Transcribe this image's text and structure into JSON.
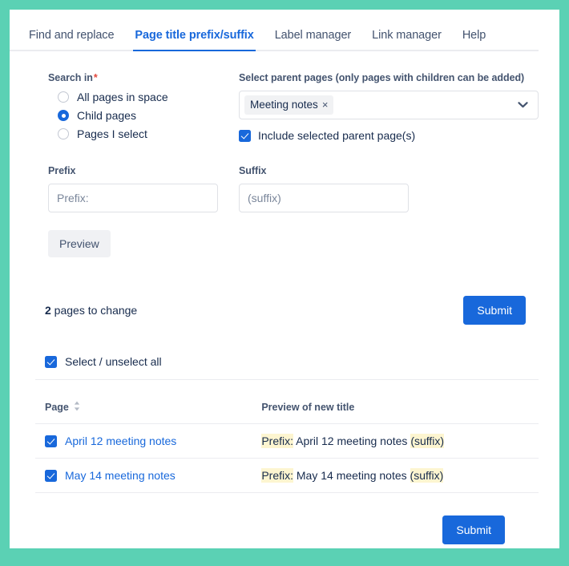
{
  "theme": {
    "accent_blue": "#1868db",
    "frame_teal": "#5bd1b4",
    "highlight_yellow": "#fdf5d0",
    "required_red": "#e2483d"
  },
  "tabs": [
    {
      "label": "Find and replace",
      "active": false
    },
    {
      "label": "Page title prefix/suffix",
      "active": true
    },
    {
      "label": "Label manager",
      "active": false
    },
    {
      "label": "Link manager",
      "active": false
    },
    {
      "label": "Help",
      "active": false
    }
  ],
  "search_in": {
    "label": "Search in",
    "required_marker": "*",
    "options": [
      {
        "label": "All pages in space",
        "selected": false
      },
      {
        "label": "Child pages",
        "selected": true
      },
      {
        "label": "Pages I select",
        "selected": false
      }
    ]
  },
  "parent_pages": {
    "label": "Select parent pages (only pages with children can be added)",
    "chips": [
      {
        "label": "Meeting notes",
        "remove_icon": "×"
      }
    ],
    "dropdown_icon": "chevron-down-icon",
    "include_parent": {
      "label": "Include selected parent page(s)",
      "checked": true
    }
  },
  "prefix_field": {
    "label": "Prefix",
    "value": "Prefix:",
    "placeholder": "Prefix:"
  },
  "suffix_field": {
    "label": "Suffix",
    "value": "(suffix)",
    "placeholder": "(suffix)"
  },
  "preview_button": {
    "label": "Preview"
  },
  "results": {
    "count_number": "2",
    "count_suffix": " pages to change",
    "submit_top_label": "Submit",
    "submit_bottom_label": "Submit",
    "select_all": {
      "label": "Select / unselect all",
      "checked": true
    },
    "columns": [
      {
        "label": "Page",
        "sortable": true
      },
      {
        "label": "Preview of new title",
        "sortable": false
      }
    ],
    "rows": [
      {
        "checked": true,
        "page": "April 12 meeting notes",
        "preview_prefix": "Prefix:",
        "preview_middle": " April 12 meeting notes ",
        "preview_suffix": "(suffix)"
      },
      {
        "checked": true,
        "page": "May 14 meeting notes",
        "preview_prefix": "Prefix:",
        "preview_middle": " May 14 meeting notes ",
        "preview_suffix": "(suffix)"
      }
    ]
  }
}
